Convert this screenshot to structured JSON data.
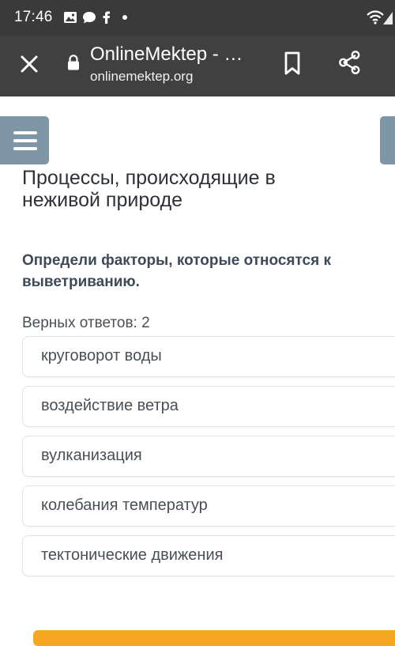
{
  "status_bar": {
    "time": "17:46",
    "left_icons": [
      "image-icon",
      "chat-icon",
      "facebook-icon",
      "dot-icon"
    ],
    "right_icons": [
      "wifi-icon",
      "signal-icon"
    ]
  },
  "browser": {
    "close_icon": "close-icon",
    "lock_icon": "lock-icon",
    "title": "OnlineMektep - …",
    "url": "onlinemektep.org",
    "bookmark_icon": "bookmark-icon",
    "share_icon": "share-icon"
  },
  "page": {
    "menu_icon": "hamburger-icon",
    "title": "Процессы, происходящие в неживой природе",
    "question": "Определи факторы, которые относятся к выветриванию.",
    "answers_count": "Верных ответов: 2",
    "options": [
      "круговорот воды",
      "воздействие ветра",
      "вулканизация",
      "колебания температур",
      "тектонические движения"
    ]
  },
  "colors": {
    "status_bar": "#3a3a3a",
    "toolbar": "#404040",
    "menu_button": "#7f96a6",
    "question_text": "#3d4a5a",
    "accent_button": "#f5a623"
  }
}
